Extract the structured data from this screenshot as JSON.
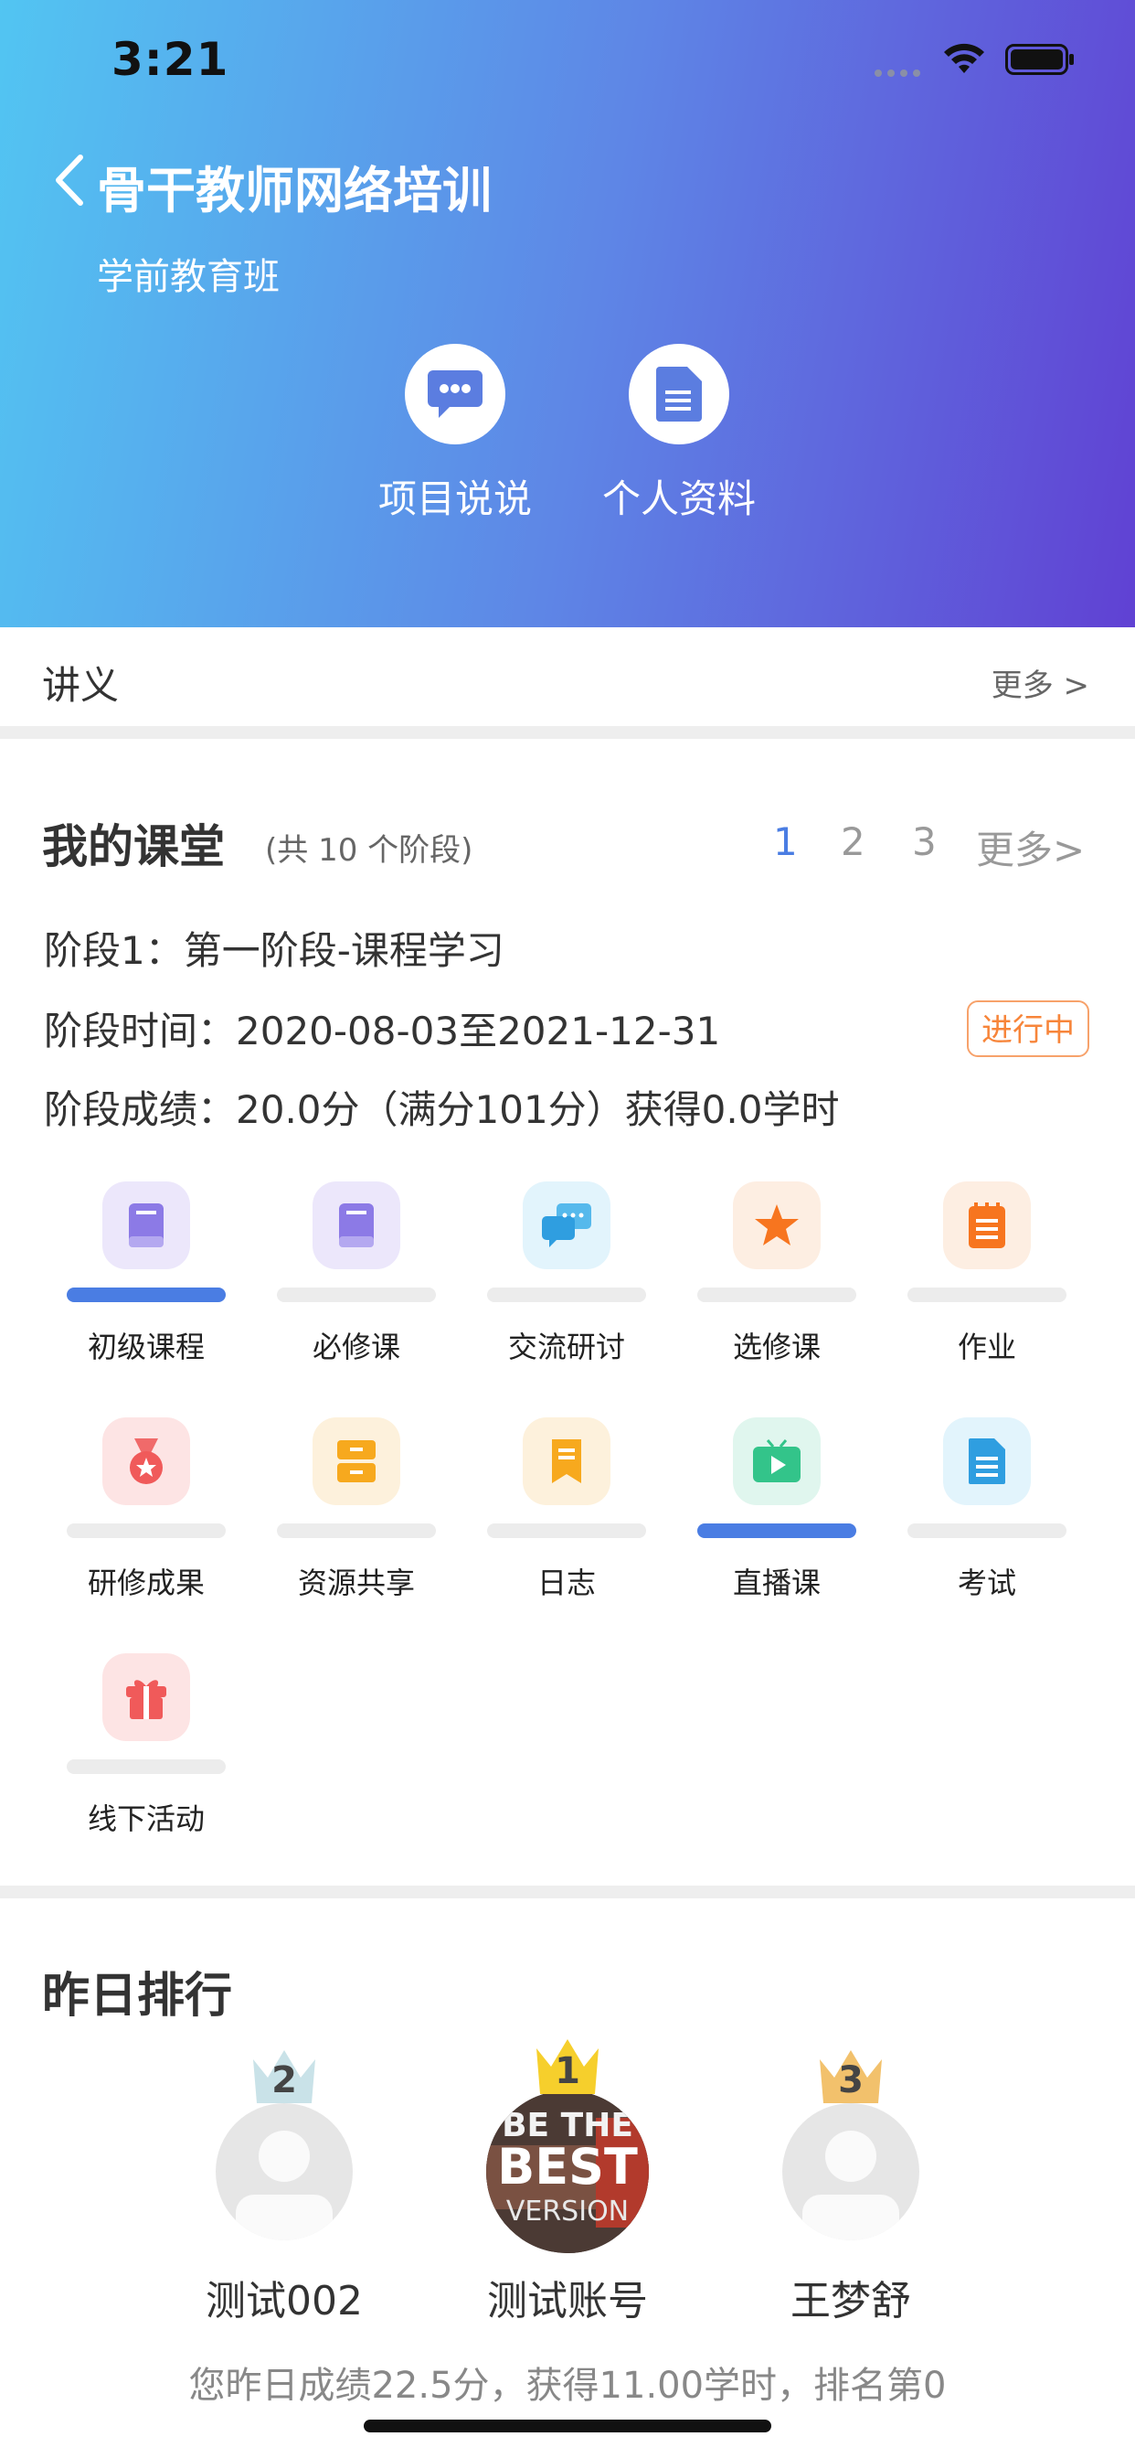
{
  "status_bar": {
    "time": "3:21"
  },
  "header": {
    "title": "骨干教师网络培训",
    "subtitle": "学前教育班",
    "actions": [
      {
        "label": "项目说说",
        "icon": "chat-bubble-icon"
      },
      {
        "label": "个人资料",
        "icon": "document-icon"
      }
    ],
    "gradient": [
      "#52c5f2",
      "#6041d3"
    ]
  },
  "handout": {
    "title": "讲义",
    "more": "更多 >"
  },
  "classroom": {
    "title": "我的课堂",
    "count": "(共 10 个阶段)",
    "pages": [
      "1",
      "2",
      "3"
    ],
    "active_page": "1",
    "more": "更多>",
    "stage_name": "阶段1：第一阶段-课程学习",
    "stage_time": "阶段时间：2020-08-03至2021-12-31",
    "stage_score": "阶段成绩：20.0分（满分101分）获得0.0学时",
    "status_badge": "进行中",
    "items": [
      {
        "label": "初级课程",
        "icon": "book-icon",
        "active": true
      },
      {
        "label": "必修课",
        "icon": "book-icon",
        "active": false
      },
      {
        "label": "交流研讨",
        "icon": "discussion-icon",
        "active": false
      },
      {
        "label": "选修课",
        "icon": "star-icon",
        "active": false
      },
      {
        "label": "作业",
        "icon": "notepad-icon",
        "active": false
      },
      {
        "label": "研修成果",
        "icon": "medal-icon",
        "active": false
      },
      {
        "label": "资源共享",
        "icon": "cabinet-icon",
        "active": false
      },
      {
        "label": "日志",
        "icon": "bookmark-icon",
        "active": false
      },
      {
        "label": "直播课",
        "icon": "tv-play-icon",
        "active": true
      },
      {
        "label": "考试",
        "icon": "exam-paper-icon",
        "active": false
      },
      {
        "label": "线下活动",
        "icon": "gift-icon",
        "active": false
      }
    ]
  },
  "ranking": {
    "title": "昨日排行",
    "users": [
      {
        "rank": "2",
        "name": "测试002"
      },
      {
        "rank": "1",
        "name": "测试账号",
        "avatar_text": [
          "BE THE",
          "BEST",
          "VERSION"
        ]
      },
      {
        "rank": "3",
        "name": "王梦舒"
      }
    ],
    "summary": "您昨日成绩22.5分，获得11.00学时，排名第0"
  },
  "colors": {
    "accent": "#4a7de3",
    "badge": "#f7853a"
  }
}
